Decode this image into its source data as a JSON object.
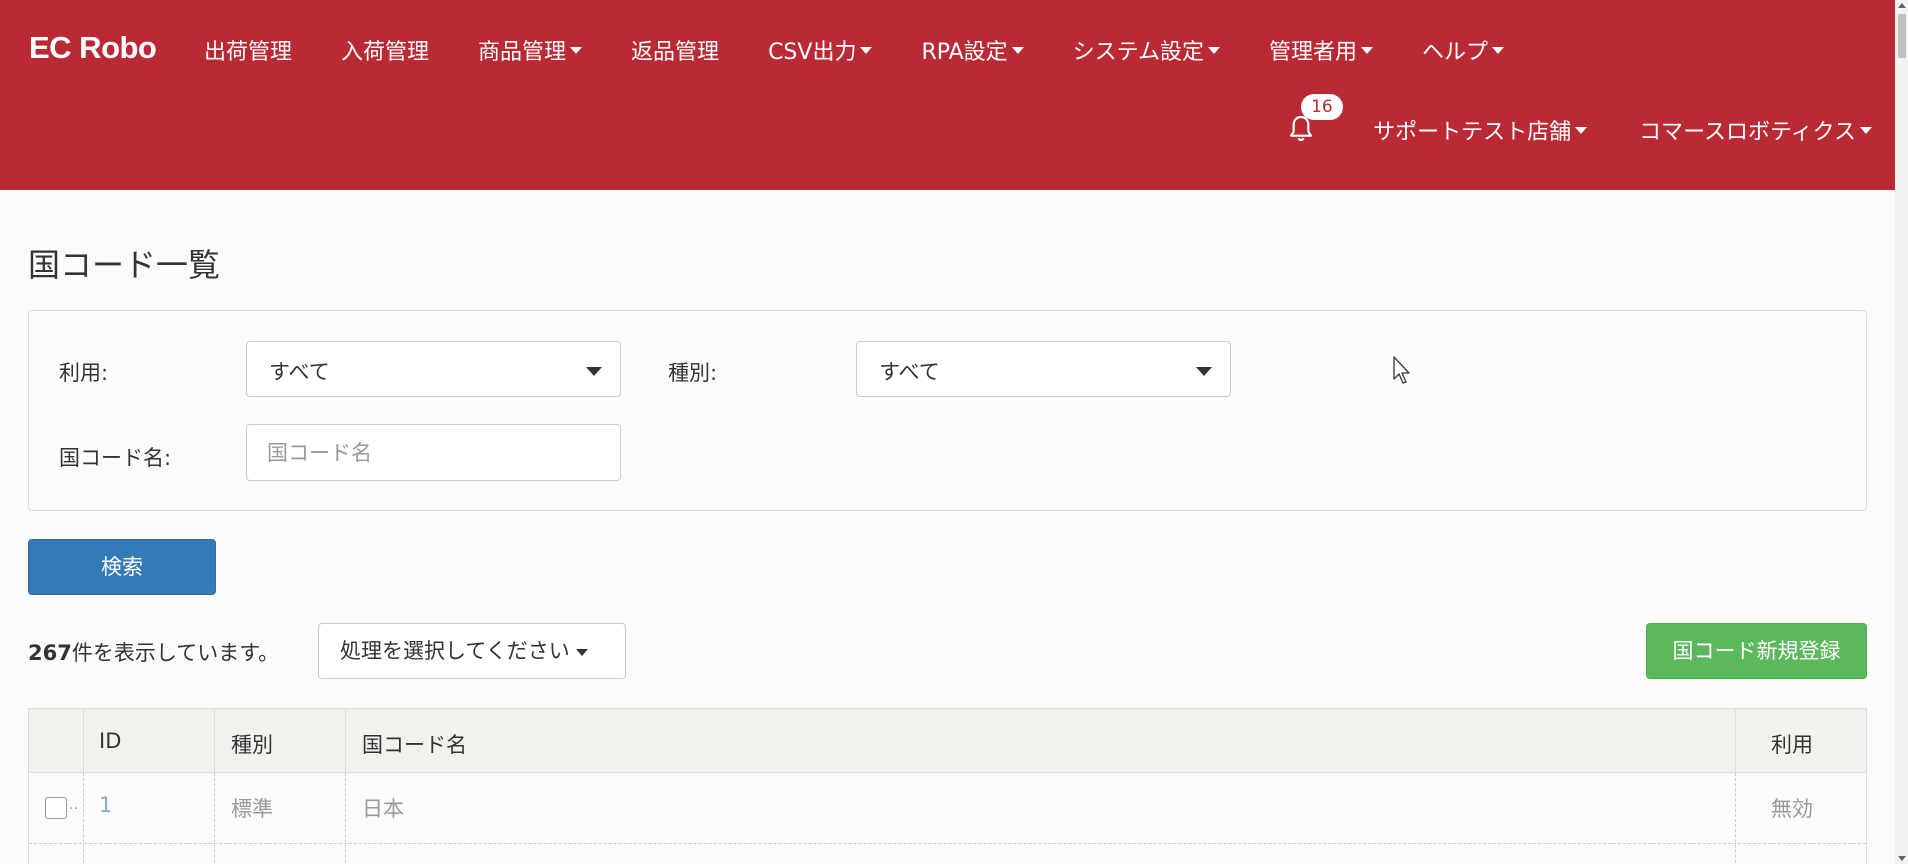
{
  "navbar": {
    "brand": "EC Robo",
    "menu": [
      {
        "label": "出荷管理",
        "dropdown": false
      },
      {
        "label": "入荷管理",
        "dropdown": false
      },
      {
        "label": "商品管理",
        "dropdown": true
      },
      {
        "label": "返品管理",
        "dropdown": false
      },
      {
        "label": "CSV出力",
        "dropdown": true
      },
      {
        "label": "RPA設定",
        "dropdown": true
      },
      {
        "label": "システム設定",
        "dropdown": true
      },
      {
        "label": "管理者用",
        "dropdown": true
      },
      {
        "label": "ヘルプ",
        "dropdown": true
      }
    ],
    "notification_count": "16",
    "shop_label": "サポートテスト店舗",
    "company_label": "コマースロボティクス"
  },
  "page": {
    "title": "国コード一覧"
  },
  "filters": {
    "usage_label": "利用:",
    "usage_value": "すべて",
    "type_label": "種別:",
    "type_value": "すべて",
    "name_label": "国コード名:",
    "name_placeholder": "国コード名",
    "name_value": ""
  },
  "actions": {
    "search_label": "検索",
    "count": "267",
    "count_suffix": "件を表示しています。",
    "bulk_action_label": "処理を選択してください",
    "new_label": "国コード新規登録"
  },
  "table": {
    "columns": [
      "ID",
      "種別",
      "国コード名",
      "利用"
    ],
    "rows": [
      {
        "id": "1",
        "type": "標準",
        "name": "日本",
        "usage": "無効"
      }
    ]
  },
  "colors": {
    "navbar": "#b92a35",
    "primary": "#337ab7",
    "success": "#5cb85c"
  }
}
